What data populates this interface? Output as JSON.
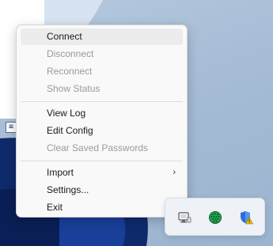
{
  "menu": {
    "items": [
      {
        "label": "Connect",
        "enabled": true,
        "hover": true
      },
      {
        "label": "Disconnect",
        "enabled": false
      },
      {
        "label": "Reconnect",
        "enabled": false
      },
      {
        "label": "Show Status",
        "enabled": false
      },
      {
        "label": "View Log",
        "enabled": true
      },
      {
        "label": "Edit Config",
        "enabled": true
      },
      {
        "label": "Clear Saved Passwords",
        "enabled": false
      },
      {
        "label": "Import",
        "enabled": true,
        "submenu": true
      },
      {
        "label": "Settings...",
        "enabled": true
      },
      {
        "label": "Exit",
        "enabled": true
      }
    ]
  },
  "tray": {
    "icons": [
      "network-computer-icon",
      "openvpn-globe-icon",
      "windows-security-warning-icon"
    ]
  },
  "colors": {
    "wallpaper": "#a9bfd6",
    "wallpaper_dark": "#0f2a6b",
    "menu_bg": "#f9f9f9",
    "disabled_text": "#9a9a9a",
    "security_blue": "#2d6fd6",
    "warning_yellow": "#f2c200",
    "globe_green": "#1fa44a"
  }
}
